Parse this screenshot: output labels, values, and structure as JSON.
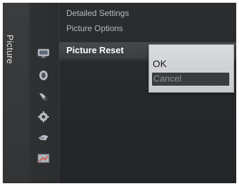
{
  "sidebar": {
    "tab_label": "Picture"
  },
  "menu": {
    "items": [
      {
        "label": "Detailed Settings"
      },
      {
        "label": "Picture Options"
      },
      {
        "label": "Picture Reset"
      }
    ]
  },
  "popup": {
    "options": [
      "OK",
      "Cancel"
    ],
    "selected": "Cancel"
  },
  "icons": [
    "picture-icon",
    "sound-icon",
    "channel-icon",
    "setup-icon",
    "input-icon",
    "application-icon"
  ],
  "colors": {
    "background": "#2b2d2f",
    "selected_item": "#474a4d",
    "popup": "#d9dbdd",
    "popup_highlight": "#3a3c3f"
  }
}
